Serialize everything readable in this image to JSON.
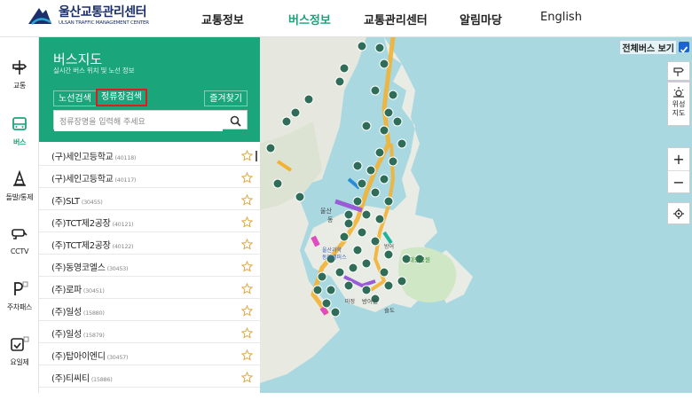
{
  "header": {
    "logo_title": "울산교통관리센터",
    "logo_sub": "ULSAN TRAFFIC MANAGEMENT CENTER",
    "nav": [
      "교통정보",
      "버스정보",
      "교통관리센터",
      "알림마당",
      "English"
    ],
    "active_nav": "버스정보"
  },
  "rail": {
    "items": [
      "교통",
      "버스",
      "돌발/통제",
      "CCTV",
      "주차패스",
      "요일제"
    ],
    "active": "버스"
  },
  "panel": {
    "title": "버스지도",
    "subtitle": "실시간 버스 위치 및 노선 정보",
    "tabs": {
      "route": "노선검색",
      "stop": "정류장검색",
      "fav": "즐겨찾기"
    },
    "search_placeholder": "정류장명을 입력해 주세요",
    "stops": [
      {
        "name": "(구)세인고등학교",
        "code": "(40118)"
      },
      {
        "name": "(구)세인고등학교",
        "code": "(40117)"
      },
      {
        "name": "(주)SLT",
        "code": "(30455)"
      },
      {
        "name": "(주)TCT제2공장",
        "code": "(40121)"
      },
      {
        "name": "(주)TCT제2공장",
        "code": "(40122)"
      },
      {
        "name": "(주)동영코엘스",
        "code": "(30453)"
      },
      {
        "name": "(주)로파",
        "code": "(30451)"
      },
      {
        "name": "(주)일성",
        "code": "(15880)"
      },
      {
        "name": "(주)일성",
        "code": "(15879)"
      },
      {
        "name": "(주)탑아이엔디",
        "code": "(30457)"
      },
      {
        "name": "(주)티씨티",
        "code": "(15886)"
      }
    ]
  },
  "map": {
    "show_all_label": "전체버스 보기",
    "satellite_label": "위성\n지도",
    "zoom_in": "+",
    "zoom_out": "−",
    "place_labels": [
      "울산",
      "동",
      "울산과학",
      "동부캠퍼스",
      "방어진",
      "대왕공원",
      "슬도",
      "방어",
      "마정"
    ]
  },
  "colors": {
    "accent": "#1aa67a",
    "header_text": "#1a2f6b",
    "highlight": "#e11b1b"
  }
}
